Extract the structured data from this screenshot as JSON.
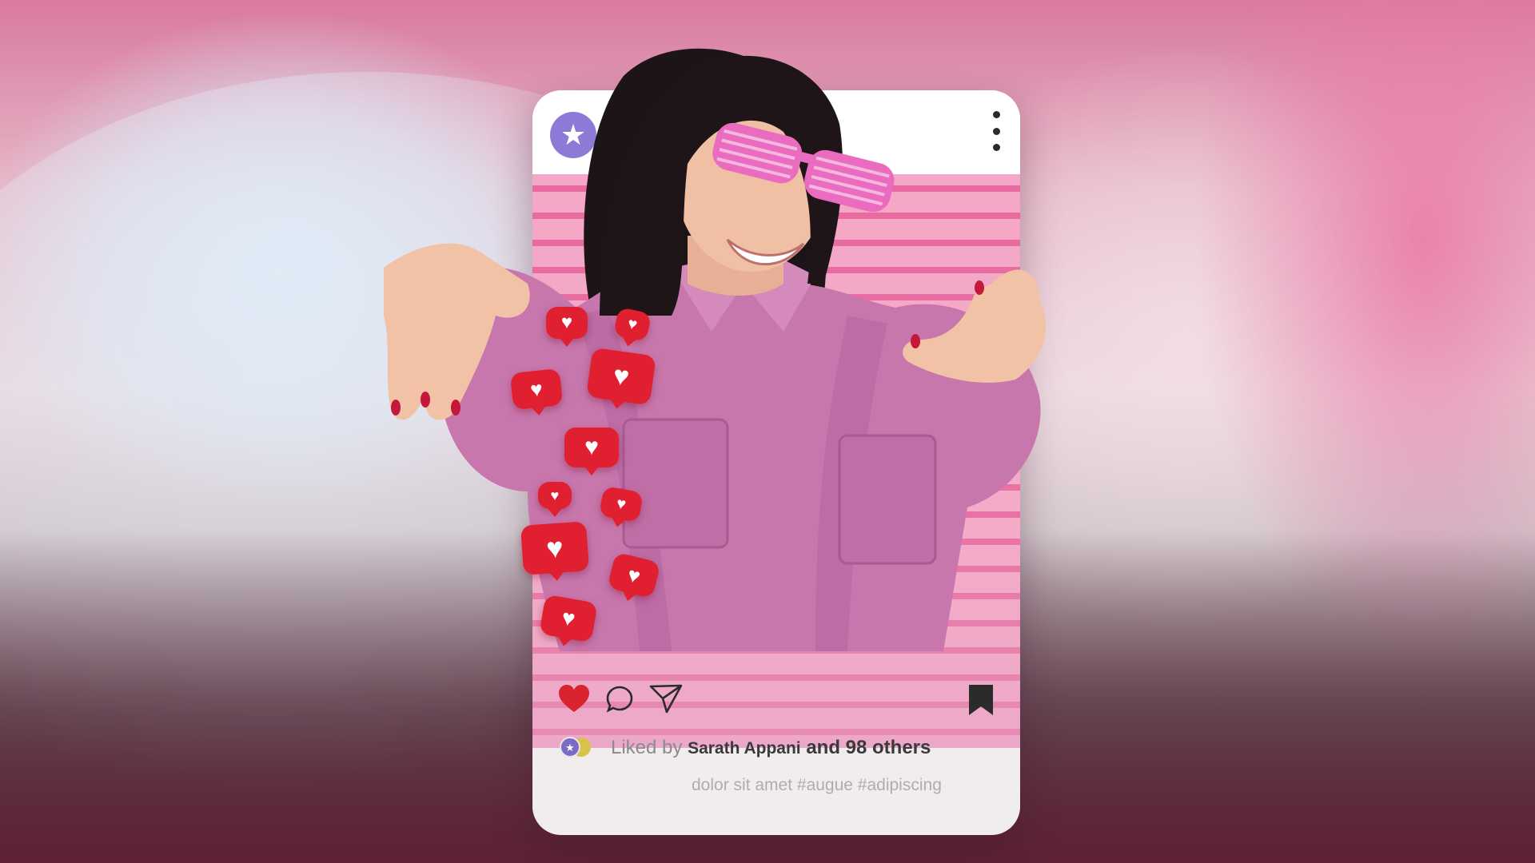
{
  "post": {
    "avatar_icon": "star-icon",
    "avatar_glyph": "★",
    "avatar_color": "#8d7ad6",
    "more_icon": "more-vertical-icon",
    "actions": {
      "like_icon": "heart-filled-icon",
      "comment_icon": "comment-bubble-icon",
      "share_icon": "paper-plane-icon",
      "save_icon": "bookmark-icon",
      "like_color": "#d9232f"
    },
    "likes": {
      "prefix": "Liked by",
      "user": "Sarath Appani",
      "suffix": "and 98 others"
    },
    "caption": "dolor sit amet  #augue #adipiscing"
  },
  "decor": {
    "reaction_icon": "heart-notification-icon",
    "reaction_color": "#e02030"
  }
}
